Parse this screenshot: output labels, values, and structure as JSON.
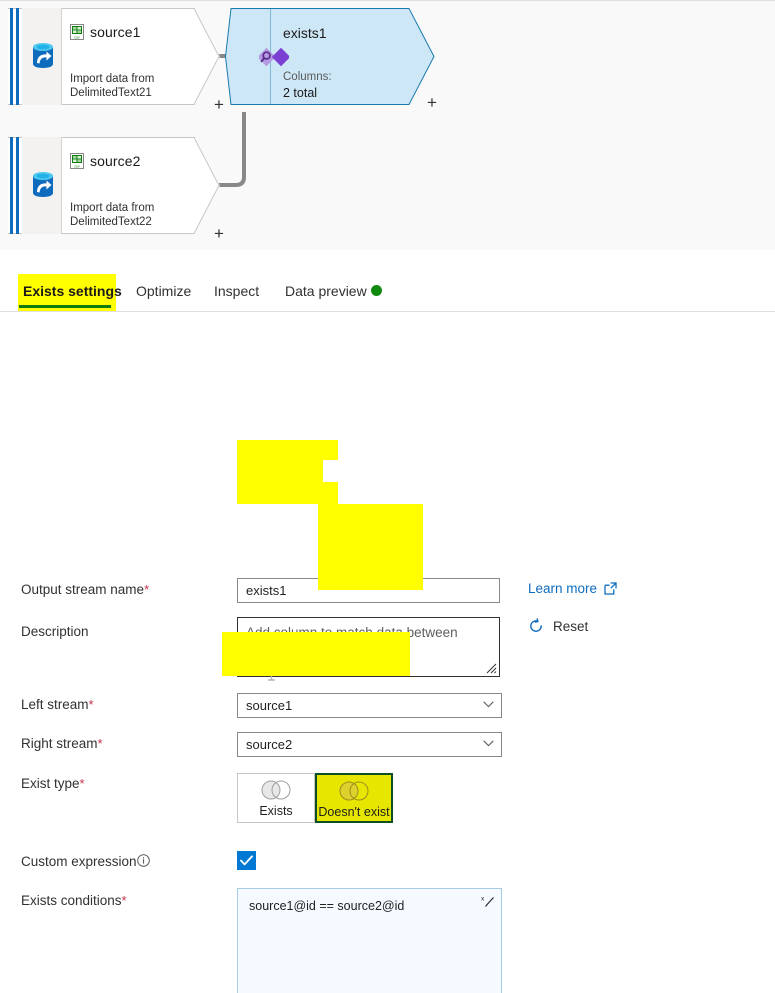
{
  "canvas": {
    "sources": [
      {
        "name": "source1",
        "description": "Import data from DelimitedText21",
        "add_label": "+",
        "file_icon": "csv-file-icon",
        "store_icon": "database-source-icon"
      },
      {
        "name": "source2",
        "description": "Import data from DelimitedText22",
        "add_label": "+",
        "file_icon": "csv-file-icon",
        "store_icon": "database-source-icon"
      }
    ],
    "transform": {
      "name": "exists1",
      "columns_label": "Columns:",
      "columns_value": "2 total",
      "add_label": "+",
      "icon": "exists-transform-icon"
    }
  },
  "tabs": [
    {
      "label": "Exists settings",
      "selected": true
    },
    {
      "label": "Optimize",
      "selected": false
    },
    {
      "label": "Inspect",
      "selected": false
    },
    {
      "label": "Data preview",
      "selected": false,
      "status_dot": "#0f8a0f"
    }
  ],
  "form": {
    "output_stream": {
      "label": "Output stream name",
      "required": "*",
      "value": "exists1"
    },
    "description": {
      "label": "Description",
      "value": "Add column to match data between sources"
    },
    "left_stream": {
      "label": "Left stream",
      "required": "*",
      "value": "source1",
      "options": [
        "source1",
        "source2"
      ]
    },
    "right_stream": {
      "label": "Right stream",
      "required": "*",
      "value": "source2",
      "options": [
        "source1",
        "source2"
      ]
    },
    "exist_type": {
      "label": "Exist type",
      "required": "*",
      "options": [
        {
          "label": "Exists",
          "selected": false
        },
        {
          "label": "Doesn't exist",
          "selected": true
        }
      ]
    },
    "custom_expression": {
      "label": "Custom expression",
      "checked": true,
      "info_icon": "info-icon"
    },
    "exists_conditions": {
      "label": "Exists conditions",
      "required": "*",
      "value": "source1@id == source2@id"
    }
  },
  "side_actions": {
    "learn_more": {
      "label": "Learn more",
      "icon": "external-link-icon"
    },
    "reset": {
      "label": "Reset",
      "icon": "refresh-icon"
    }
  },
  "colors": {
    "accent_blue": "#0f6cbd",
    "highlight_yellow": "#ffff00",
    "selected_green_border": "#0b4f23",
    "selected_green_fill": "#e6e600",
    "tab_underline_green": "#107c10",
    "status_green": "#0f8a0f",
    "required_red": "#c4314b",
    "exists_node_fill": "#cde7f7",
    "connector_gray": "#8a8886"
  }
}
